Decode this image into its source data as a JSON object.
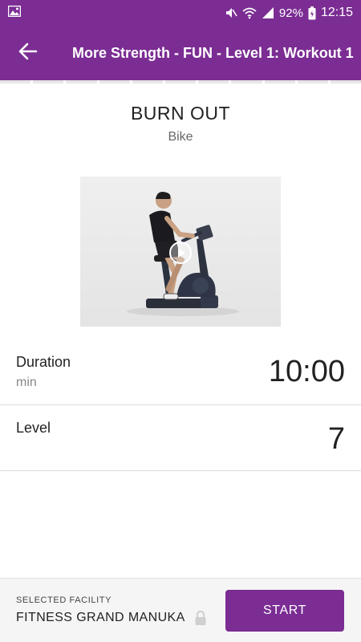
{
  "status_bar": {
    "battery_percent": "92%",
    "time": "12:15",
    "icons": [
      "image-icon",
      "mute-icon",
      "wifi-icon",
      "signal-icon",
      "battery-icon"
    ]
  },
  "app_bar": {
    "title": "More Strength - FUN - Level 1: Workout 1",
    "back_icon": "arrow-left-icon"
  },
  "exercise": {
    "name": "BURN OUT",
    "equipment": "Bike",
    "video_icon": "play-icon"
  },
  "details": [
    {
      "label": "Duration",
      "unit": "min",
      "value": "10:00"
    },
    {
      "label": "Level",
      "unit": "",
      "value": "7"
    }
  ],
  "footer": {
    "facility_caption": "SELECTED FACILITY",
    "facility_name": "FITNESS GRAND MANUKA",
    "lock_icon": "lock-icon",
    "start_label": "START"
  },
  "colors": {
    "brand": "#7b2d93",
    "divider": "#dcdcdc"
  }
}
